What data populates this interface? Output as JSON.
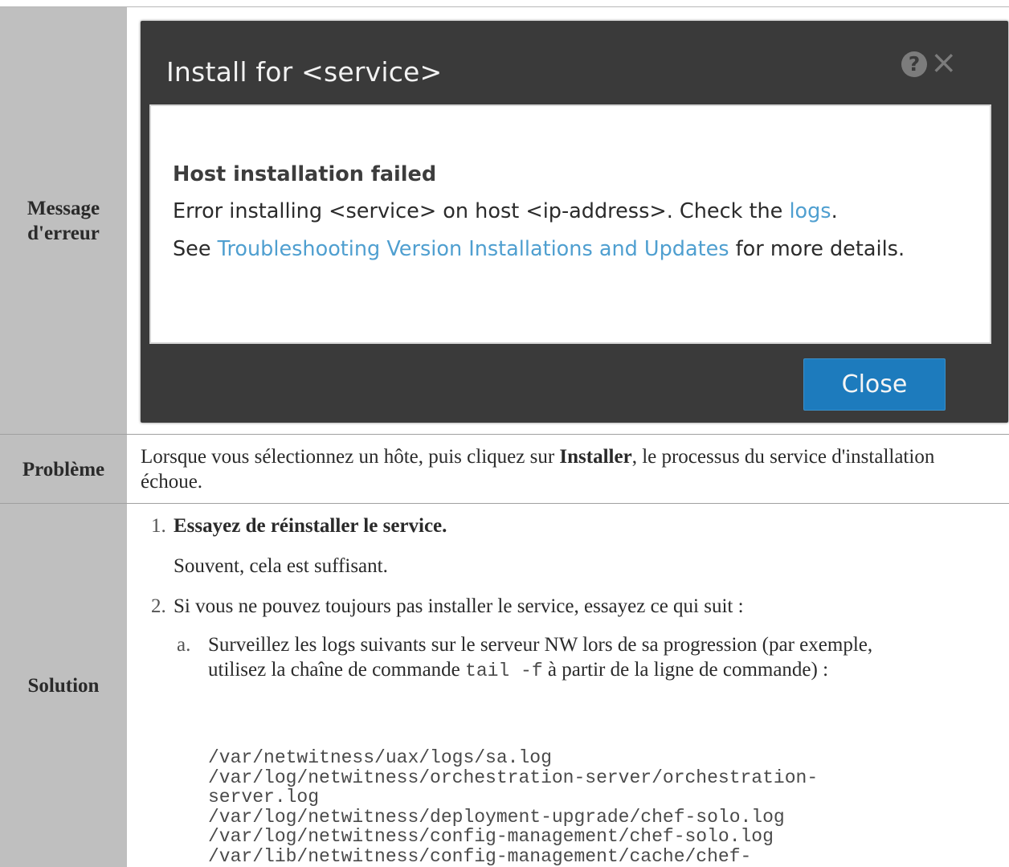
{
  "table": {
    "headers": {
      "error_line1": "Message",
      "error_line2": "d'erreur",
      "problem": "Problème",
      "solution": "Solution"
    },
    "dialog": {
      "title": "Install for <service>",
      "help_icon": "?",
      "close_icon": "×",
      "heading": "Host installation failed",
      "line1_prefix": "Error installing <service>  on host <ip-address>.  Check the ",
      "line1_link": "logs",
      "line1_suffix": ".",
      "line2_prefix": "See ",
      "line2_link": "Troubleshooting Version Installations and Updates",
      "line2_suffix": " for more details.",
      "close_button": "Close"
    },
    "problem": {
      "text_before": "Lorsque vous sélectionnez un hôte, puis cliquez sur ",
      "text_bold": "Installer",
      "text_after": ", le processus du service d'installation échoue."
    },
    "solution": {
      "step1_num": "1.",
      "step1_title": "Essayez de réinstaller le service.",
      "step1_note": "Souvent, cela est suffisant.",
      "step2_num": "2.",
      "step2_text": "Si vous ne pouvez toujours pas installer le service, essayez ce qui suit :",
      "step2a_letter": "a.",
      "step2a_before": "Surveillez les logs suivants sur le serveur NW lors de sa progression (par exemple, utilisez la chaîne de commande ",
      "step2a_code": "tail -f",
      "step2a_after": " à partir de la ligne de commande) :",
      "log_paths": [
        "/var/netwitness/uax/logs/sa.log",
        "/var/log/netwitness/orchestration-server/orchestration-",
        "server.log",
        "/var/log/netwitness/deployment-upgrade/chef-solo.log",
        "/var/log/netwitness/config-management/chef-solo.log",
        "/var/lib/netwitness/config-management/cache/chef-"
      ]
    }
  }
}
